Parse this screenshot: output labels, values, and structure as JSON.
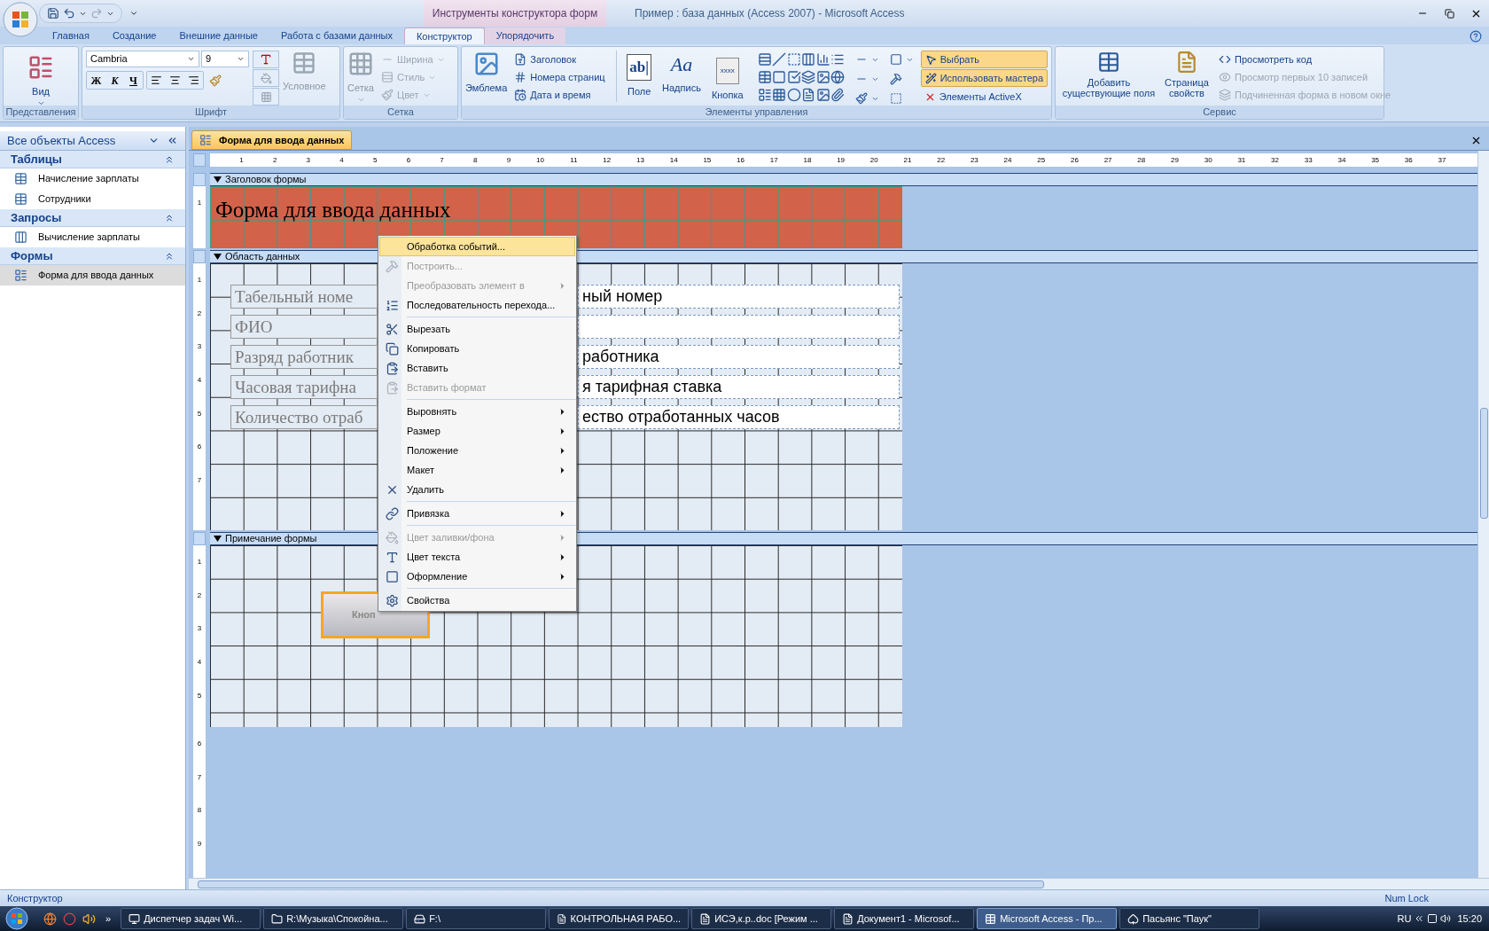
{
  "title_bar": {
    "contextual_group": "Инструменты конструктора форм",
    "title": "Пример : база данных (Access 2007) - Microsoft Access"
  },
  "ribbon_tabs": [
    {
      "label": "Главная",
      "selected": false,
      "contextual": false
    },
    {
      "label": "Создание",
      "selected": false,
      "contextual": false
    },
    {
      "label": "Внешние данные",
      "selected": false,
      "contextual": false
    },
    {
      "label": "Работа с базами данных",
      "selected": false,
      "contextual": false
    },
    {
      "label": "Конструктор",
      "selected": true,
      "contextual": true
    },
    {
      "label": "Упорядочить",
      "selected": false,
      "contextual": true
    }
  ],
  "ribbon": {
    "views": {
      "label": "Представления",
      "view_button": "Вид"
    },
    "font": {
      "label": "Шрифт",
      "font_name": "Cambria",
      "font_size": "9",
      "bold": "Ж",
      "italic": "К",
      "underline": "Ч",
      "conditional": {
        "label": "Условное",
        "disabled": true
      }
    },
    "gridlines": {
      "label": "Сетка",
      "button": {
        "label": "Сетка",
        "disabled": true
      },
      "items": [
        {
          "label": "Ширина",
          "disabled": true
        },
        {
          "label": "Стиль",
          "disabled": true
        },
        {
          "label": "Цвет",
          "disabled": true
        }
      ]
    },
    "controls": {
      "label": "Элементы управления",
      "logo": "Эмблема",
      "header_items": [
        "Заголовок",
        "Номера страниц",
        "Дата и время"
      ],
      "big_controls": [
        {
          "label": "Поле",
          "glyph": "ab|"
        },
        {
          "label": "Надпись",
          "glyph": "Aa"
        },
        {
          "label": "Кнопка",
          "glyph": "xxxx"
        }
      ],
      "toggles": [
        {
          "label": "Выбрать",
          "selected": true
        },
        {
          "label": "Использовать мастера",
          "selected": true
        }
      ],
      "activex": "Элементы ActiveX"
    },
    "tools": {
      "label": "Сервис",
      "add_fields": "Добавить существующие поля",
      "property_sheet": "Страница свойств",
      "links": [
        {
          "label": "Просмотреть код",
          "disabled": false
        },
        {
          "label": "Просмотр первых 10 записей",
          "disabled": true
        },
        {
          "label": "Подчиненная форма в новом окне",
          "disabled": true
        }
      ]
    }
  },
  "nav_pane": {
    "title": "Все объекты Access",
    "groups": [
      {
        "label": "Таблицы",
        "expanded": true,
        "items": [
          {
            "label": "Начисление зарплаты",
            "kind": "table",
            "selected": false
          },
          {
            "label": "Сотрудники",
            "kind": "table",
            "selected": false
          }
        ]
      },
      {
        "label": "Запросы",
        "expanded": true,
        "items": [
          {
            "label": "Вычисление зарплаты",
            "kind": "query",
            "selected": false
          }
        ]
      },
      {
        "label": "Формы",
        "expanded": true,
        "items": [
          {
            "label": "Форма для ввода данных",
            "kind": "form",
            "selected": true
          }
        ]
      }
    ]
  },
  "document_tab": "Форма для ввода данных",
  "ruler_marks": [
    "1",
    "2",
    "3",
    "4",
    "5",
    "6",
    "7",
    "8",
    "9",
    "10",
    "11",
    "12",
    "13",
    "14",
    "15",
    "16",
    "17",
    "18",
    "19",
    "20",
    "21",
    "22",
    "23",
    "24",
    "25",
    "26",
    "27",
    "28",
    "29",
    "30",
    "31",
    "32",
    "33",
    "34",
    "35",
    "36",
    "37"
  ],
  "sections": [
    {
      "kind": "header",
      "title": "Заголовок формы",
      "ruler_marks": [
        "1"
      ]
    },
    {
      "kind": "detail",
      "title": "Область данных",
      "ruler_marks": [
        "1",
        "2",
        "3",
        "4",
        "5",
        "6",
        "7"
      ]
    },
    {
      "kind": "footer",
      "title": "Примечание формы",
      "ruler_marks": [
        "1",
        "2",
        "3",
        "4",
        "5",
        "6",
        "7",
        "8",
        "9"
      ]
    }
  ],
  "form_title": "Форма для ввода данных",
  "fields": [
    {
      "label": "Табельный номе",
      "value": "ный номер"
    },
    {
      "label": "ФИО"
    },
    {
      "label": "Разряд работник",
      "value": "работника"
    },
    {
      "label": "Часовая тарифна",
      "value": "я тарифная ставка"
    },
    {
      "label": "Количество отраб",
      "value": "ество отработанных часов"
    }
  ],
  "footer_button": {
    "label": "Кноп",
    "selected": true
  },
  "context_menu": [
    {
      "kind": "item",
      "label": "Обработка событий...",
      "selected": true,
      "disabled": false,
      "submenu": false
    },
    {
      "kind": "item",
      "label": "Построить...",
      "selected": false,
      "disabled": true,
      "submenu": false
    },
    {
      "kind": "item",
      "label": "Преобразовать элемент в",
      "selected": false,
      "disabled": true,
      "submenu": true
    },
    {
      "kind": "item",
      "label": "Последовательность перехода...",
      "selected": false,
      "disabled": false,
      "submenu": false
    },
    {
      "kind": "separator"
    },
    {
      "kind": "item",
      "label": "Вырезать",
      "selected": false,
      "disabled": false,
      "submenu": false
    },
    {
      "kind": "item",
      "label": "Копировать",
      "selected": false,
      "disabled": false,
      "submenu": false
    },
    {
      "kind": "item",
      "label": "Вставить",
      "selected": false,
      "disabled": false,
      "submenu": false
    },
    {
      "kind": "item",
      "label": "Вставить формат",
      "selected": false,
      "disabled": true,
      "submenu": false
    },
    {
      "kind": "separator"
    },
    {
      "kind": "item",
      "label": "Выровнять",
      "selected": false,
      "disabled": false,
      "submenu": true
    },
    {
      "kind": "item",
      "label": "Размер",
      "selected": false,
      "disabled": false,
      "submenu": true
    },
    {
      "kind": "item",
      "label": "Положение",
      "selected": false,
      "disabled": false,
      "submenu": true
    },
    {
      "kind": "item",
      "label": "Макет",
      "selected": false,
      "disabled": false,
      "submenu": true
    },
    {
      "kind": "item",
      "label": "Удалить",
      "selected": false,
      "disabled": false,
      "submenu": false
    },
    {
      "kind": "separator"
    },
    {
      "kind": "item",
      "label": "Привязка",
      "selected": false,
      "disabled": false,
      "submenu": true
    },
    {
      "kind": "separator"
    },
    {
      "kind": "item",
      "label": "Цвет заливки/фона",
      "selected": false,
      "disabled": true,
      "submenu": true
    },
    {
      "kind": "item",
      "label": "Цвет текста",
      "selected": false,
      "disabled": false,
      "submenu": true
    },
    {
      "kind": "item",
      "label": "Оформление",
      "selected": false,
      "disabled": false,
      "submenu": true
    },
    {
      "kind": "separator"
    },
    {
      "kind": "item",
      "label": "Свойства",
      "selected": false,
      "disabled": false,
      "submenu": false
    }
  ],
  "status_bar": {
    "mode": "Конструктор",
    "indicator": "Num Lock"
  },
  "taskbar": {
    "more": "»",
    "buttons": [
      {
        "label": "Диспетчер задач Wi...",
        "selected": false
      },
      {
        "label": "R:\\Музыка\\Спокойна...",
        "selected": false
      },
      {
        "label": "F:\\",
        "selected": false
      },
      {
        "label": "КОНТРОЛЬНАЯ РАБО...",
        "selected": false
      },
      {
        "label": "ИСЭ,к.р..doc [Режим ...",
        "selected": false
      },
      {
        "label": "Документ1 - Microsof...",
        "selected": false
      },
      {
        "label": "Microsoft Access - Пр...",
        "selected": true
      },
      {
        "label": "Пасьянс \"Паук\"",
        "selected": false
      }
    ],
    "language": "RU",
    "time": "15:20"
  }
}
